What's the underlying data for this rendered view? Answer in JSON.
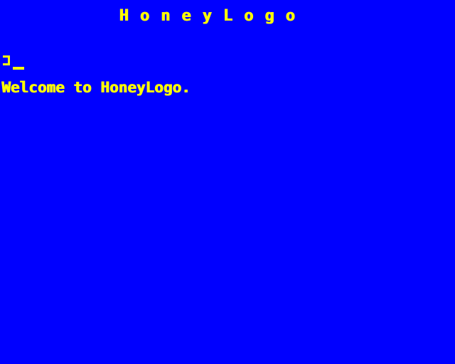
{
  "window": {
    "title": "HoneyLogo"
  },
  "console": {
    "lines": [
      "Welcome to HoneyLogo."
    ],
    "prompt": "]",
    "input_value": ""
  },
  "colors": {
    "background": "#0000FF",
    "text": "#FFFF00"
  },
  "icons": {
    "prompt": "prompt-bracket",
    "cursor": "block-underscore-cursor"
  }
}
